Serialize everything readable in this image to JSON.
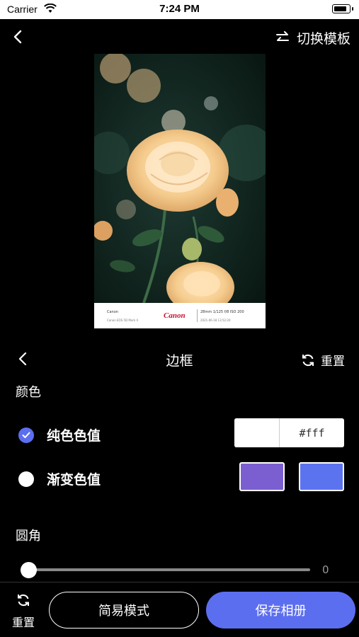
{
  "status_bar": {
    "carrier": "Carrier",
    "time": "7:24 PM",
    "battery_level": 0.9
  },
  "header": {
    "switch_template_label": "切换模板"
  },
  "photo": {
    "footer": {
      "model_line1": "Canon",
      "model_line2": "Canon EOS 5D Mark II",
      "brand": "Canon",
      "params": "28mm  1/125  f/8  ISO 200",
      "date": "2021-06-18 13:52:20"
    }
  },
  "panel": {
    "title": "边框",
    "reset_label": "重置",
    "color_section_label": "颜色",
    "solid_option_label": "纯色色值",
    "solid_value": "#fff",
    "gradient_option_label": "渐变色值",
    "gradient_color_start": "#7b5fd0",
    "gradient_color_end": "#5c73f0",
    "radius_section_label": "圆角",
    "radius_value": "0",
    "radius_fraction": 0
  },
  "bottom_bar": {
    "reset_label": "重置",
    "simple_mode_label": "简易模式",
    "save_label": "保存相册"
  },
  "colors": {
    "accent": "#5c6ef0",
    "background": "#000000"
  }
}
